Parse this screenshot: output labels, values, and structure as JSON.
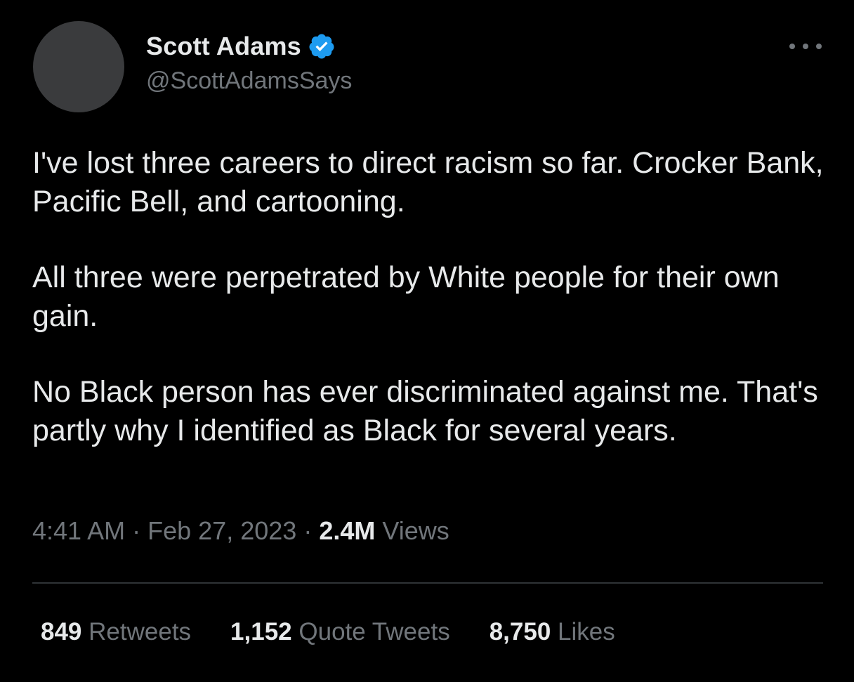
{
  "author": {
    "display_name": "Scott Adams",
    "handle": "@ScottAdamsSays",
    "verified": true,
    "verified_color": "#1d9bf0",
    "avatar_color": "#3a3b3d"
  },
  "more_icon": "more-horizontal-icon",
  "tweet": {
    "paragraphs": [
      "I've lost three careers to direct racism so far. Crocker Bank, Pacific Bell, and cartooning.",
      "All three were perpetrated by White people for their own gain.",
      "No Black person has ever discriminated against me. That's partly why I identified as Black for several years."
    ],
    "time": "4:41 AM",
    "separator": "·",
    "date": "Feb 27, 2023",
    "views_count": "2.4M",
    "views_label": "Views"
  },
  "stats": {
    "retweets_count": "849",
    "retweets_label": "Retweets",
    "quotes_count": "1,152",
    "quotes_label": "Quote Tweets",
    "likes_count": "8,750",
    "likes_label": "Likes"
  },
  "colors": {
    "background": "#000000",
    "primary_text": "#e7e9ea",
    "secondary_text": "#71767b",
    "divider": "#2f3336"
  }
}
